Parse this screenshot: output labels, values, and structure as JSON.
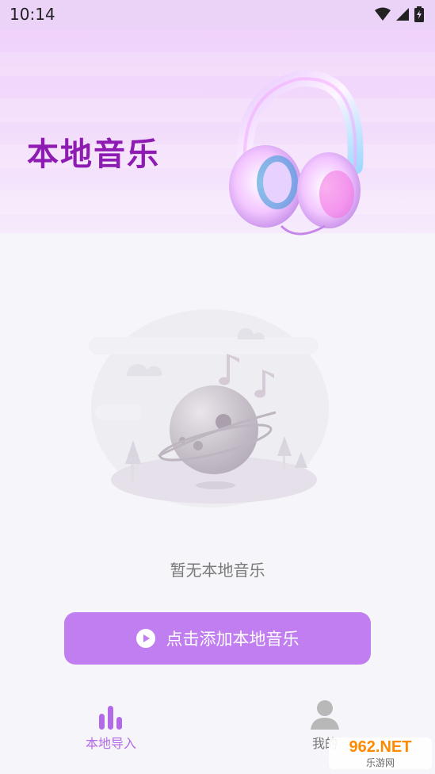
{
  "status_bar": {
    "time": "10:14"
  },
  "header": {
    "title": "本地音乐"
  },
  "empty_state": {
    "text": "暂无本地音乐"
  },
  "add_button": {
    "label": "点击添加本地音乐"
  },
  "bottom_nav": {
    "items": [
      {
        "label": "本地导入",
        "icon": "bar-chart-icon",
        "active": true
      },
      {
        "label": "我的",
        "icon": "user-icon",
        "active": false
      }
    ]
  },
  "watermark": {
    "top": "962.NET",
    "bottom": "乐游网"
  },
  "colors": {
    "accent": "#c07ef0",
    "title": "#8e1cb3",
    "nav_active": "#b26ae6"
  }
}
